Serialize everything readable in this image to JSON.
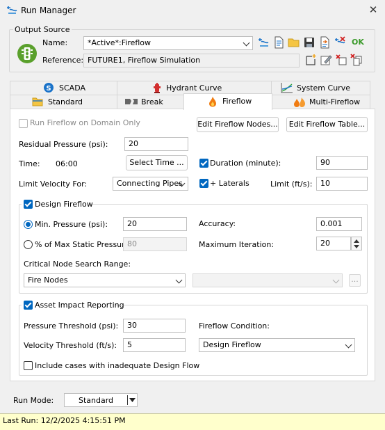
{
  "window": {
    "title": "Run Manager",
    "close_glyph": "✕"
  },
  "output_source": {
    "legend": "Output Source",
    "name_label": "Name:",
    "name_value": "*Active*:Fireflow",
    "reference_label": "Reference:",
    "reference_value": "FUTURE1, Fireflow Simulation",
    "ok_label": "OK"
  },
  "tabs": {
    "row1": [
      "SCADA",
      "Hydrant Curve",
      "System Curve"
    ],
    "row2": [
      "Standard",
      "Break",
      "Fireflow",
      "Multi-Fireflow"
    ],
    "active": "Fireflow"
  },
  "fireflow": {
    "run_domain_only_label": "Run Fireflow on Domain Only",
    "run_domain_only_checked": false,
    "edit_nodes_button": "Edit Fireflow Nodes...",
    "edit_table_button": "Edit Fireflow Table...",
    "residual_pressure_label": "Residual Pressure (psi):",
    "residual_pressure_value": "20",
    "time_label": "Time:",
    "time_value": "06:00",
    "select_time_button": "Select Time ...",
    "duration_label": "Duration (minute):",
    "duration_checked": true,
    "duration_value": "90",
    "limit_velocity_label": "Limit Velocity For:",
    "limit_velocity_value": "Connecting Pipes",
    "laterals_label": "+ Laterals",
    "laterals_checked": true,
    "limit_label": "Limit (ft/s):",
    "limit_value": "10"
  },
  "design_fireflow": {
    "legend": "Design Fireflow",
    "checked": true,
    "min_pressure_label": "Min. Pressure (psi):",
    "min_pressure_value": "20",
    "pct_static_label": "% of Max Static Pressure:",
    "pct_static_value": "80",
    "accuracy_label": "Accuracy:",
    "accuracy_value": "0.001",
    "max_iteration_label": "Maximum Iteration:",
    "max_iteration_value": "20",
    "search_range_label": "Critical Node Search Range:",
    "search_range_value": "Fire Nodes",
    "ellipsis_label": "..."
  },
  "asset_impact": {
    "legend": "Asset Impact Reporting",
    "checked": true,
    "pressure_threshold_label": "Pressure Threshold (psi):",
    "pressure_threshold_value": "30",
    "velocity_threshold_label": "Velocity Threshold (ft/s):",
    "velocity_threshold_value": "5",
    "condition_label": "Fireflow Condition:",
    "condition_value": "Design Fireflow",
    "include_cases_label": "Include cases with inadequate Design Flow",
    "include_cases_checked": false
  },
  "run_mode": {
    "label": "Run Mode:",
    "value": "Standard"
  },
  "status": {
    "last_run": "Last Run: 12/2/2025 4:15:51 PM"
  },
  "colors": {
    "accent": "#0067c0",
    "status_bg": "#ffffcc",
    "fireflow_orange": "#f07c12",
    "traffic_green": "#5aa02c"
  }
}
